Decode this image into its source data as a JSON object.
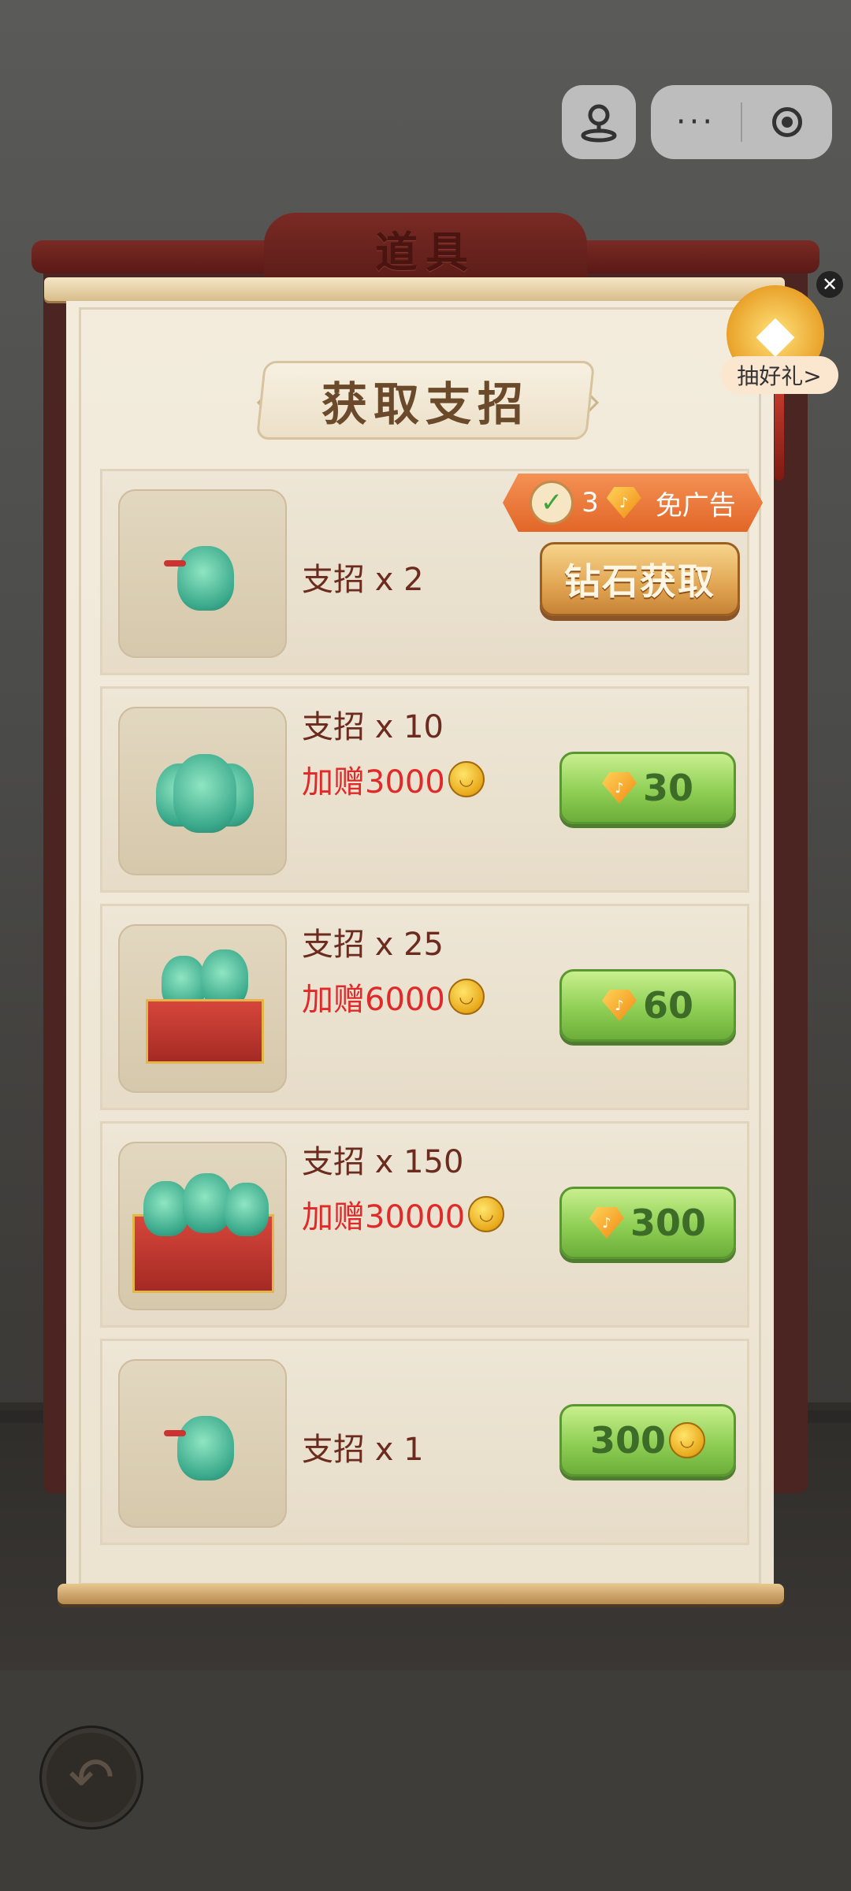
{
  "title": "道具",
  "header": "获取支招",
  "top_capsule": {
    "more": "···"
  },
  "side_widget": {
    "label": "抽好礼>",
    "close": "✕"
  },
  "items": [
    {
      "name": "支招 x 2",
      "badge": {
        "count": "3",
        "label": "免广告"
      },
      "button": "钻石获取"
    },
    {
      "name": "支招 x 10",
      "bonus": "加赠3000",
      "price": "30",
      "currency": "diamond"
    },
    {
      "name": "支招 x 25",
      "bonus": "加赠6000",
      "price": "60",
      "currency": "diamond"
    },
    {
      "name": "支招 x 150",
      "bonus": "加赠30000",
      "price": "300",
      "currency": "diamond"
    },
    {
      "name": "支招 x 1",
      "price": "300",
      "currency": "coin"
    }
  ],
  "colors": {
    "accent_red": "#e02a2a",
    "button_green": "#8fcf55",
    "scroll_dark": "#5a1c18"
  }
}
